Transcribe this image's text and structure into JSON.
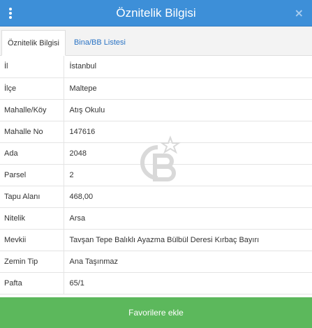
{
  "header": {
    "title": "Öznitelik Bilgisi",
    "close": "×"
  },
  "tabs": [
    {
      "label": "Öznitelik Bilgisi"
    },
    {
      "label": "Bina/BB Listesi"
    }
  ],
  "rows": [
    {
      "key": "İl",
      "value": "İstanbul"
    },
    {
      "key": "İlçe",
      "value": "Maltepe"
    },
    {
      "key": "Mahalle/Köy",
      "value": "Atış Okulu"
    },
    {
      "key": "Mahalle No",
      "value": "147616"
    },
    {
      "key": "Ada",
      "value": "2048"
    },
    {
      "key": "Parsel",
      "value": "2"
    },
    {
      "key": "Tapu Alanı",
      "value": "468,00"
    },
    {
      "key": "Nitelik",
      "value": "Arsa"
    },
    {
      "key": "Mevkii",
      "value": "Tavşan Tepe Balıklı Ayazma Bülbül Deresi Kırbaç Bayırı"
    },
    {
      "key": "Zemin Tip",
      "value": "Ana Taşınmaz"
    },
    {
      "key": "Pafta",
      "value": "65/1"
    }
  ],
  "footer": {
    "button_label": "Favorilere ekle"
  },
  "colors": {
    "header": "#3d8fd8",
    "footer": "#5cb85c",
    "link": "#2a73c4"
  }
}
